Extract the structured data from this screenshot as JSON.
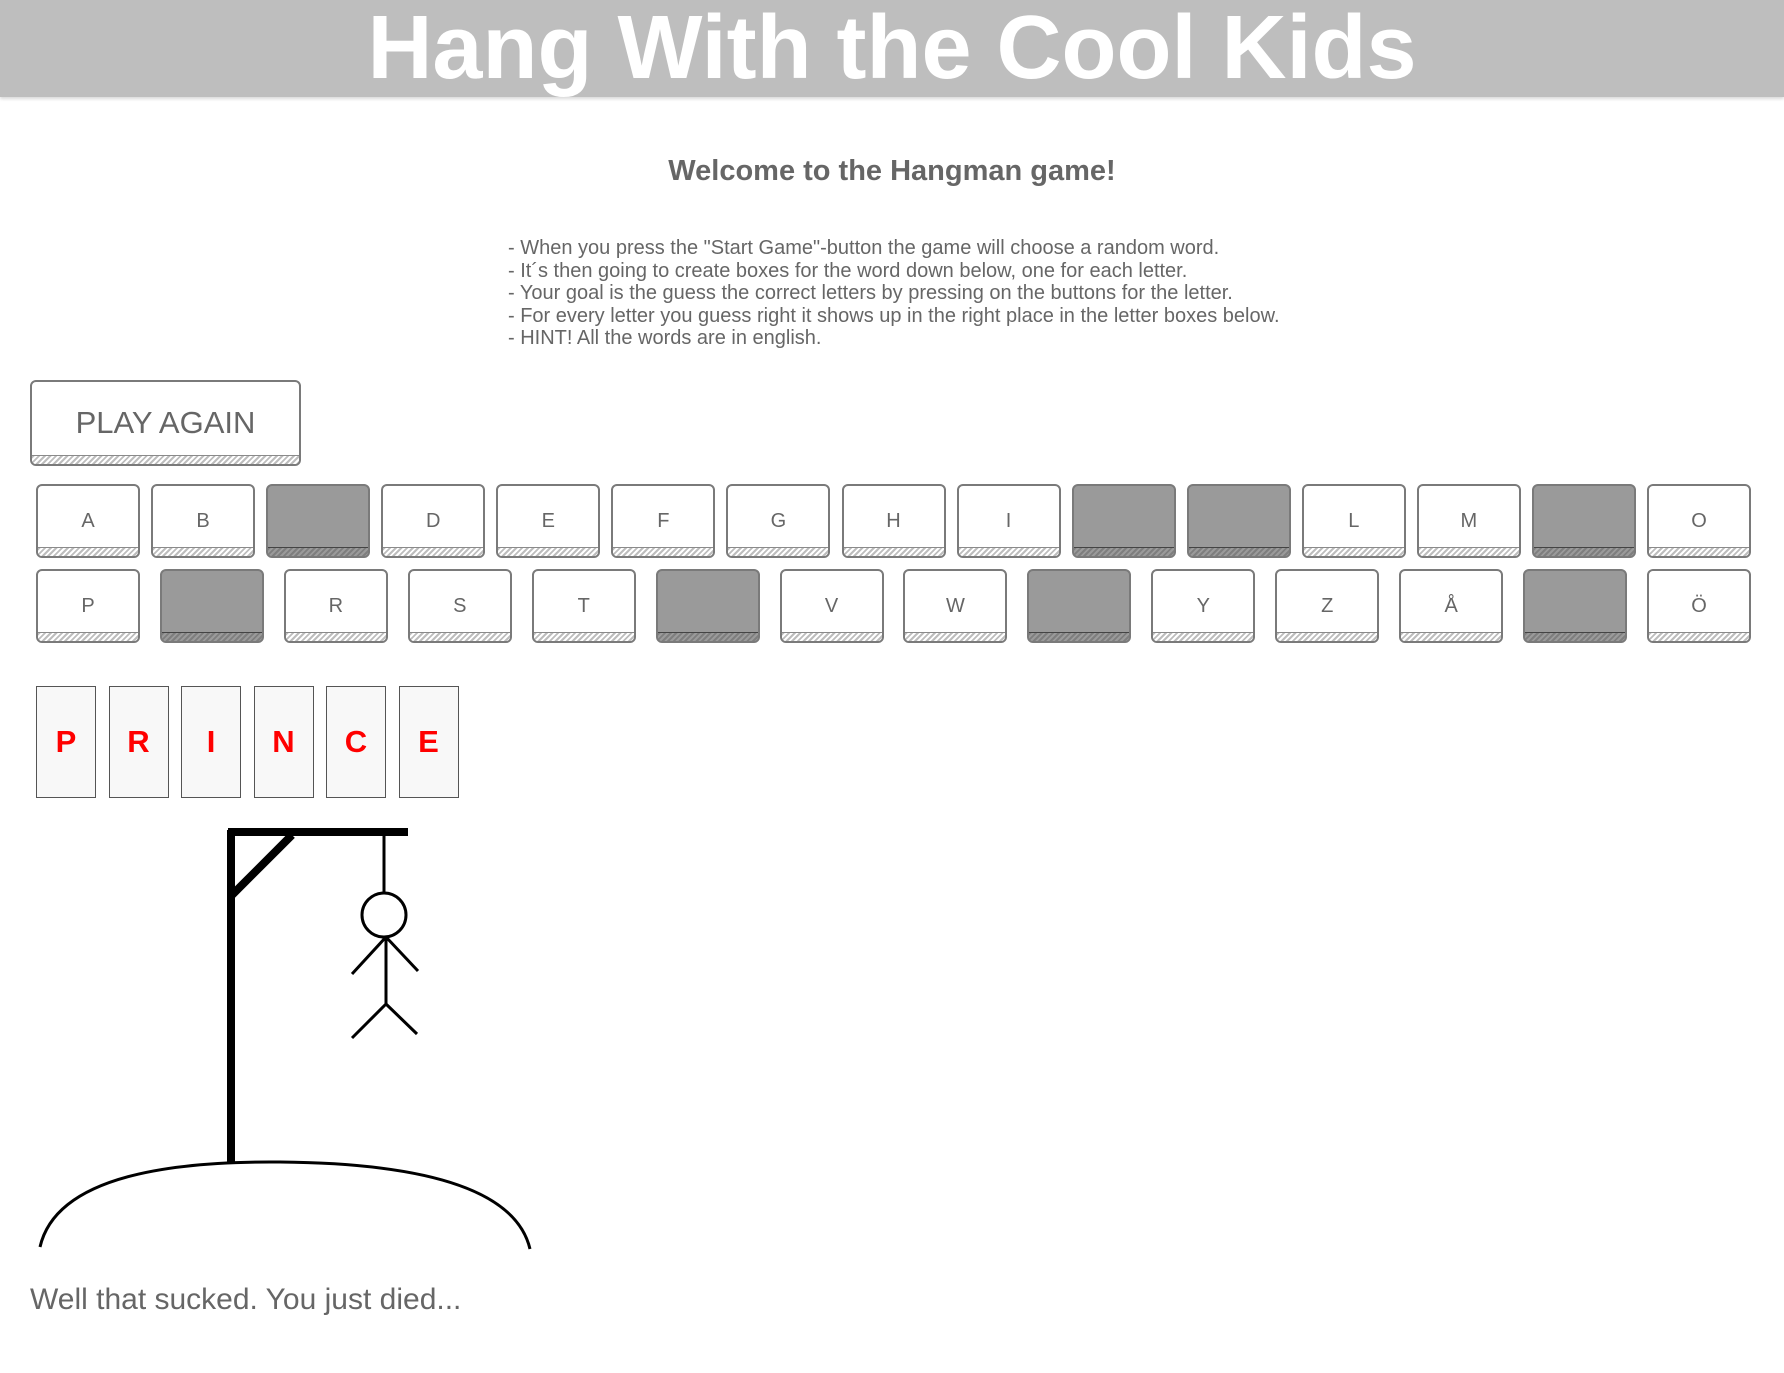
{
  "header": {
    "title": "Hang With the Cool Kids"
  },
  "welcome": "Welcome to the Hangman game!",
  "instructions": [
    "- When you press the \"Start Game\"-button the game will choose a random word.",
    "- It´s then going to create boxes for the word down below, one for each letter.",
    "- Your goal is the guess the correct letters by pressing on the buttons for the letter.",
    "- For every letter you guess right it shows up in the right place in the letter boxes below.",
    "- HINT! All the words are in english."
  ],
  "play_button": {
    "label": "PLAY AGAIN"
  },
  "keyboard": {
    "row1": [
      {
        "label": "A",
        "used": false
      },
      {
        "label": "B",
        "used": false
      },
      {
        "label": "",
        "used": true
      },
      {
        "label": "D",
        "used": false
      },
      {
        "label": "E",
        "used": false
      },
      {
        "label": "F",
        "used": false
      },
      {
        "label": "G",
        "used": false
      },
      {
        "label": "H",
        "used": false
      },
      {
        "label": "I",
        "used": false
      },
      {
        "label": "",
        "used": true
      },
      {
        "label": "",
        "used": true
      },
      {
        "label": "L",
        "used": false
      },
      {
        "label": "M",
        "used": false
      },
      {
        "label": "",
        "used": true
      },
      {
        "label": "O",
        "used": false
      }
    ],
    "row2": [
      {
        "label": "P",
        "used": false
      },
      {
        "label": "",
        "used": true
      },
      {
        "label": "R",
        "used": false
      },
      {
        "label": "S",
        "used": false
      },
      {
        "label": "T",
        "used": false
      },
      {
        "label": "",
        "used": true
      },
      {
        "label": "V",
        "used": false
      },
      {
        "label": "W",
        "used": false
      },
      {
        "label": "",
        "used": true
      },
      {
        "label": "Y",
        "used": false
      },
      {
        "label": "Z",
        "used": false
      },
      {
        "label": "Å",
        "used": false
      },
      {
        "label": "",
        "used": true
      },
      {
        "label": "Ö",
        "used": false
      }
    ]
  },
  "word_letters": [
    "P",
    "R",
    "I",
    "N",
    "C",
    "E"
  ],
  "colors": {
    "header_bg": "#bebebe",
    "used_key": "#9a9a9a",
    "word_letter": "#ff0000",
    "text": "#666666"
  },
  "message": "Well that sucked. You just died..."
}
